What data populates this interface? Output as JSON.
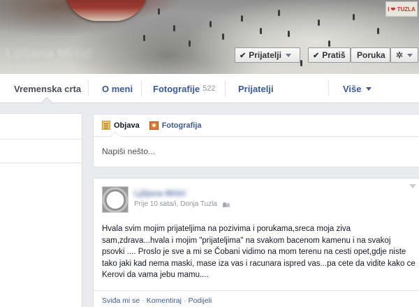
{
  "cover": {
    "profile_name": "Ljiljana Mišić",
    "sign_text": "I ❤ TUZLA",
    "buttons": {
      "friends": "Prijatelji",
      "follow": "Pratiš",
      "message": "Poruka"
    }
  },
  "nav": {
    "tabs": [
      {
        "label": "Vremenska crta"
      },
      {
        "label": "O meni"
      },
      {
        "label": "Fotografije",
        "count": "522"
      },
      {
        "label": "Prijatelji"
      },
      {
        "label": "Više"
      }
    ]
  },
  "composer": {
    "tab_post": "Objava",
    "tab_photo": "Fotografija",
    "placeholder": "Napiši nešto..."
  },
  "post": {
    "author": "Ljiljana Mišić",
    "meta": "Prije 10 sata/i, Donja Tuzla",
    "text_lines": [
      "Hvala svim mojim prijateljima na pozivima i porukama,sreca moja ziva",
      "sam,zdrava...hvala i mojim \"prijateljima\" na svakom bacenom kamenu i na svakoj",
      "psovki .... Proslo je sve a mi se Čobani vidimo na mom terenu na cesti opet,gdje niste",
      "tako jaki kad nema maski, mase iza vas i racunara ispred vas...pa cete da vidite kako ce",
      "Kerovi da vama jebu mamu...."
    ],
    "actions": {
      "like": "Sviđa mi se",
      "comment": "Komentiraj",
      "share": "Podijeli"
    }
  },
  "colors": {
    "link": "#3b5998",
    "page_bg": "#e9ebee",
    "muted": "#90949c"
  },
  "icons": [
    "check-icon",
    "caret-down-icon",
    "gear-icon",
    "post-icon",
    "photo-icon",
    "friends-audience-icon",
    "chevron-down-icon"
  ]
}
